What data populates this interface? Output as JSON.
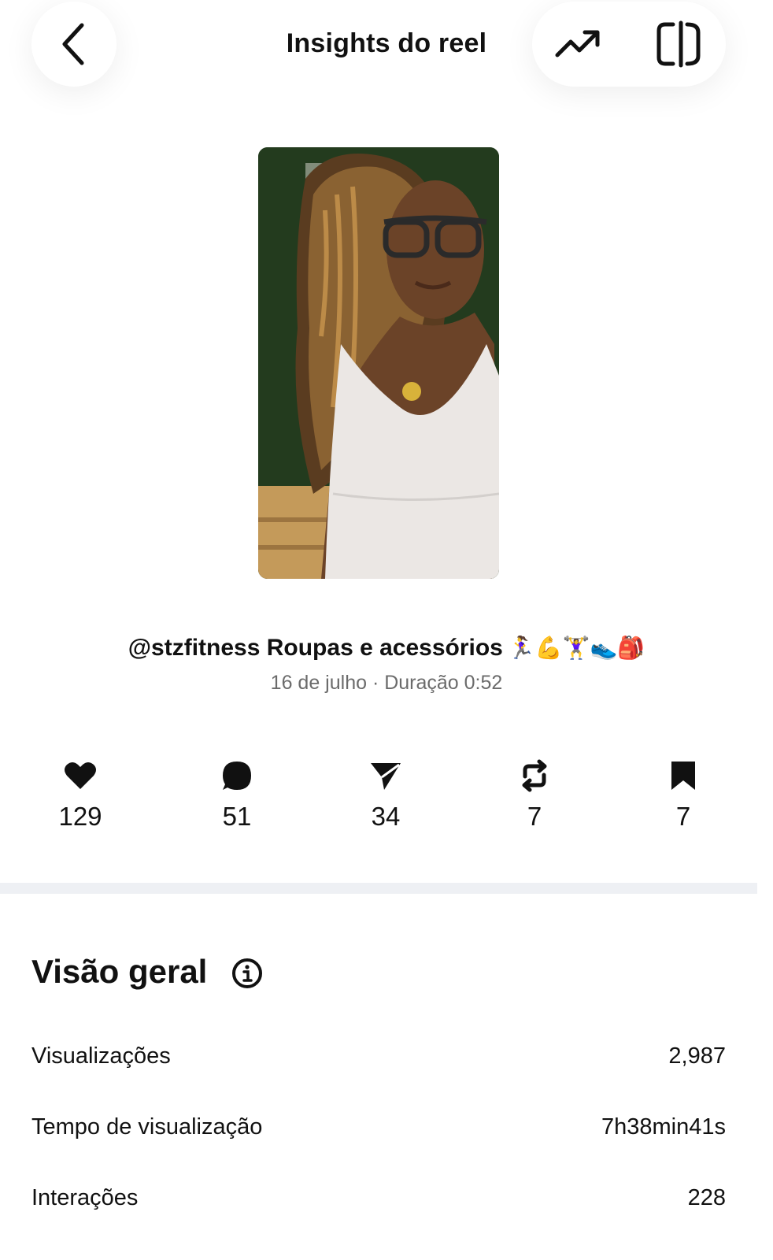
{
  "header": {
    "title": "Insights do reel",
    "back_icon": "chevron-left-icon",
    "trend_icon": "trending-up-icon",
    "panel_icon": "panel-toggle-icon"
  },
  "reel": {
    "thumbnail": "reel-thumbnail",
    "caption": "@stzfitness Roupas e acessórios",
    "caption_emojis": "🏃‍♀️💪🏋️‍♀️👟🎒",
    "date_duration": "16 de julho · Duração 0:52"
  },
  "stats": [
    {
      "icon": "heart-icon",
      "value": "129"
    },
    {
      "icon": "comment-icon",
      "value": "51"
    },
    {
      "icon": "share-icon",
      "value": "34"
    },
    {
      "icon": "repost-icon",
      "value": "7"
    },
    {
      "icon": "bookmark-icon",
      "value": "7"
    }
  ],
  "overview": {
    "title": "Visão geral",
    "info_icon": "info-icon",
    "rows": [
      {
        "label": "Visualizações",
        "value": "2,987"
      },
      {
        "label": "Tempo de visualização",
        "value": "7h38min41s"
      },
      {
        "label": "Interações",
        "value": "228"
      }
    ]
  }
}
